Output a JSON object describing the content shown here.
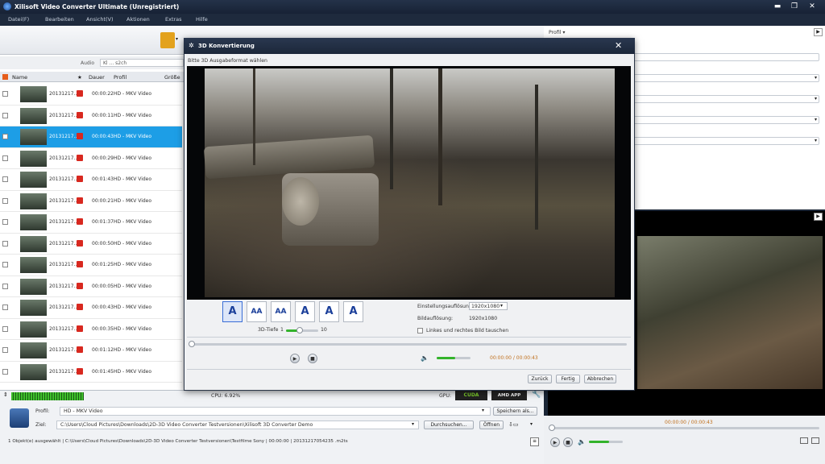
{
  "app": {
    "title": "Xilisoft Video Converter Ultimate (Unregistriert)"
  },
  "menu": [
    "Datei(F)",
    "Bearbeiten",
    "Ansicht(V)",
    "Aktionen",
    "Extras",
    "Hilfe"
  ],
  "audio": {
    "label": "Audio",
    "value": "Kl ... s2ch"
  },
  "list_headers": {
    "name": "Name",
    "duration": "Dauer",
    "profile": "Profil",
    "size": "Größe"
  },
  "rows": [
    {
      "date": "20131217...",
      "dur": "00:00:22",
      "prof": "HD - MKV Video",
      "checked": false
    },
    {
      "date": "20131217...",
      "dur": "00:00:11",
      "prof": "HD - MKV Video",
      "checked": false
    },
    {
      "date": "20131217...",
      "dur": "00:00:43",
      "prof": "HD - MKV Video",
      "checked": true
    },
    {
      "date": "20131217...",
      "dur": "00:00:29",
      "prof": "HD - MKV Video",
      "checked": false
    },
    {
      "date": "20131217...",
      "dur": "00:01:43",
      "prof": "HD - MKV Video",
      "checked": false
    },
    {
      "date": "20131217...",
      "dur": "00:00:21",
      "prof": "HD - MKV Video",
      "checked": false
    },
    {
      "date": "20131217...",
      "dur": "00:01:37",
      "prof": "HD - MKV Video",
      "checked": false
    },
    {
      "date": "20131217...",
      "dur": "00:00:50",
      "prof": "HD - MKV Video",
      "checked": false
    },
    {
      "date": "20131217...",
      "dur": "00:01:25",
      "prof": "HD - MKV Video",
      "checked": false
    },
    {
      "date": "20131217...",
      "dur": "00:00:05",
      "prof": "HD - MKV Video",
      "checked": false
    },
    {
      "date": "20131217...",
      "dur": "00:00:43",
      "prof": "HD - MKV Video",
      "checked": false
    },
    {
      "date": "20131217...",
      "dur": "00:00:35",
      "prof": "HD - MKV Video",
      "checked": false
    },
    {
      "date": "20131217...",
      "dur": "00:01:12",
      "prof": "HD - MKV Video",
      "checked": false
    },
    {
      "date": "20131217...",
      "dur": "00:01:45",
      "prof": "HD - MKV Video",
      "checked": false
    }
  ],
  "right": {
    "profile_label": "Profil ▾"
  },
  "dialog": {
    "title": "3D Konvertierung",
    "subtitle": "Bitte 3D Ausgabeformat wählen",
    "modes": [
      "A",
      "AA",
      "AA",
      "A",
      "A",
      "A"
    ],
    "depth_label": "3D-Tiefe",
    "depth_min": "1",
    "depth_max": "10",
    "depth_value": 0.42,
    "res_output_label": "Einstellungsauflösung:",
    "res_output_value": "1920x1080",
    "res_image_label": "Bildauflösung:",
    "res_image_value": "1920x1080",
    "swap_label": "Linkes und rechtes Bild tauschen",
    "time": "00:00:00 / 00:00:43",
    "volume": 0.55,
    "btn_reset": "Zurück",
    "btn_done": "Fertig",
    "btn_cancel": "Abbrechen"
  },
  "status": {
    "cpu": "CPU: 6.92%",
    "gpu_label": "GPU:",
    "cuda": "CUDA",
    "amd": "AMD APP"
  },
  "bottom": {
    "profile_label": "Profil:",
    "profile_value": "HD - MKV Video",
    "save_as": "Speichern als...",
    "target_label": "Ziel:",
    "target_path": "C:\\Users\\Cloud Pictures\\Downloads\\2D-3D Video Converter Testversionen\\Xilisoft 3D Converter Demo",
    "browse": "Durchsuchen...",
    "open": "Öffnen",
    "statusline": "1 Objekt(e) ausgewählt | C:\\Users\\Cloud Pictures\\Downloads\\2D-3D Video Converter Testversionen\\Testfilme Sony | 00:00:00 | 20131217054235 .m2ts"
  },
  "preview": {
    "time": "00:00:00 / 00:00:43",
    "volume": 0.6
  }
}
